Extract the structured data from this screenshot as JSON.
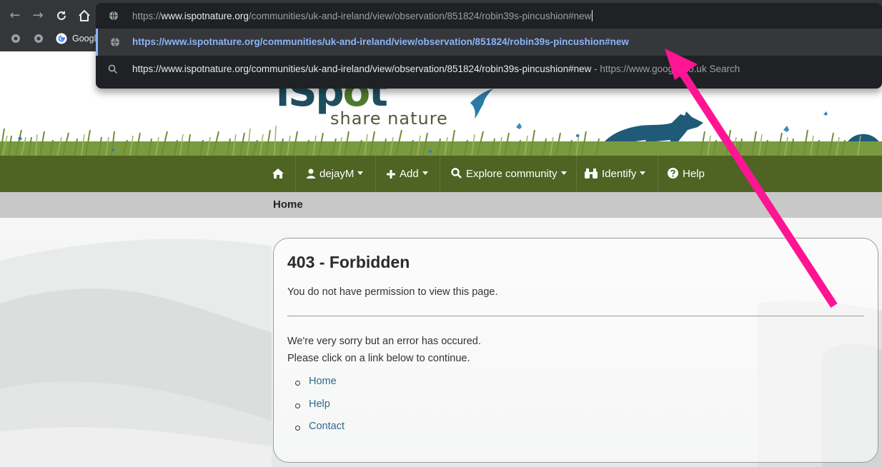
{
  "browser": {
    "back_icon": "back-arrow-icon",
    "forward_icon": "forward-arrow-icon",
    "reload_icon": "reload-icon",
    "home_icon": "home-icon",
    "address": {
      "prefix": "https://",
      "host": "www.ispotnature.org",
      "path": "/communities/uk-and-ireland/view/observation/851824/robin39s-pincushion#new"
    },
    "bookmark_label": "Googl",
    "suggestions": [
      {
        "text": "https://www.ispotnature.org/communities/uk-and-ireland/view/observation/851824/robin39s-pincushion#new",
        "icon": "globe-icon"
      },
      {
        "text": "https://www.ispotnature.org/communities/uk-and-ireland/view/observation/851824/robin39s-pincushion#new",
        "separator": " - ",
        "hint": "https://www.google.co.uk Search",
        "icon": "search-icon"
      }
    ],
    "accent_color": "#8ab4f8"
  },
  "site": {
    "logo_main": "iSp",
    "logo_o": "o",
    "logo_end": "t",
    "tagline": "share nature",
    "nav": {
      "home_icon": "home-icon",
      "user": "dejayM",
      "add": "Add",
      "explore": "Explore community",
      "identify": "Identify",
      "help": "Help"
    },
    "nav_color": "#4f6323",
    "breadcrumb": "Home"
  },
  "error": {
    "title": "403 - Forbidden",
    "subtitle": "You do not have permission to view this page.",
    "message_line1": "We're very sorry but an error has occured.",
    "message_line2": "Please click on a link below to continue.",
    "links": [
      "Home",
      "Help",
      "Contact"
    ],
    "link_color": "#2d6b8a"
  },
  "annotation": {
    "arrow_color": "#ff1493"
  }
}
